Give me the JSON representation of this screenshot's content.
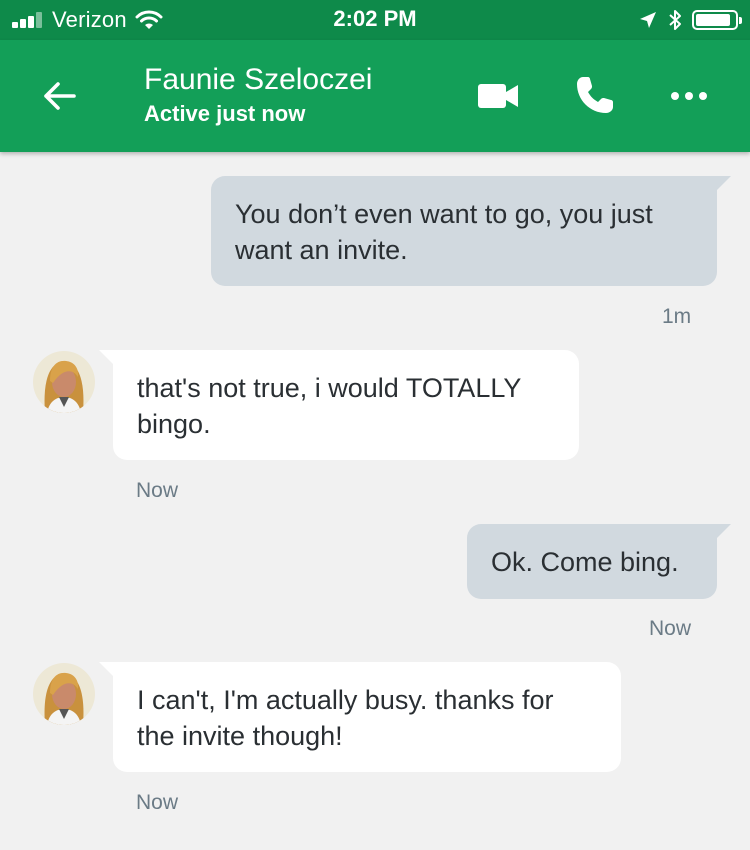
{
  "status_bar": {
    "carrier": "Verizon",
    "time": "2:02 PM"
  },
  "header": {
    "contact_name": "Faunie Szeloczei",
    "status": "Active just now",
    "icons": [
      "back-arrow-icon",
      "video-camera-icon",
      "phone-icon",
      "more-icon"
    ]
  },
  "messages": [
    {
      "direction": "outgoing",
      "text": "You don’t even want to go, you just want an invite.",
      "time": "1m"
    },
    {
      "direction": "incoming",
      "text": "that's not true, i would TOTALLY bingo.",
      "time": "Now"
    },
    {
      "direction": "outgoing",
      "text": "Ok. Come bing.",
      "time": "Now"
    },
    {
      "direction": "incoming",
      "text": "I can't, I'm actually busy. thanks for the invite though!",
      "time": "Now"
    }
  ],
  "colors": {
    "status_bar": "#0e8a4a",
    "header": "#139f58",
    "outgoing_bubble": "#d1d9df",
    "incoming_bubble": "#ffffff",
    "background": "#f1f1f1"
  }
}
